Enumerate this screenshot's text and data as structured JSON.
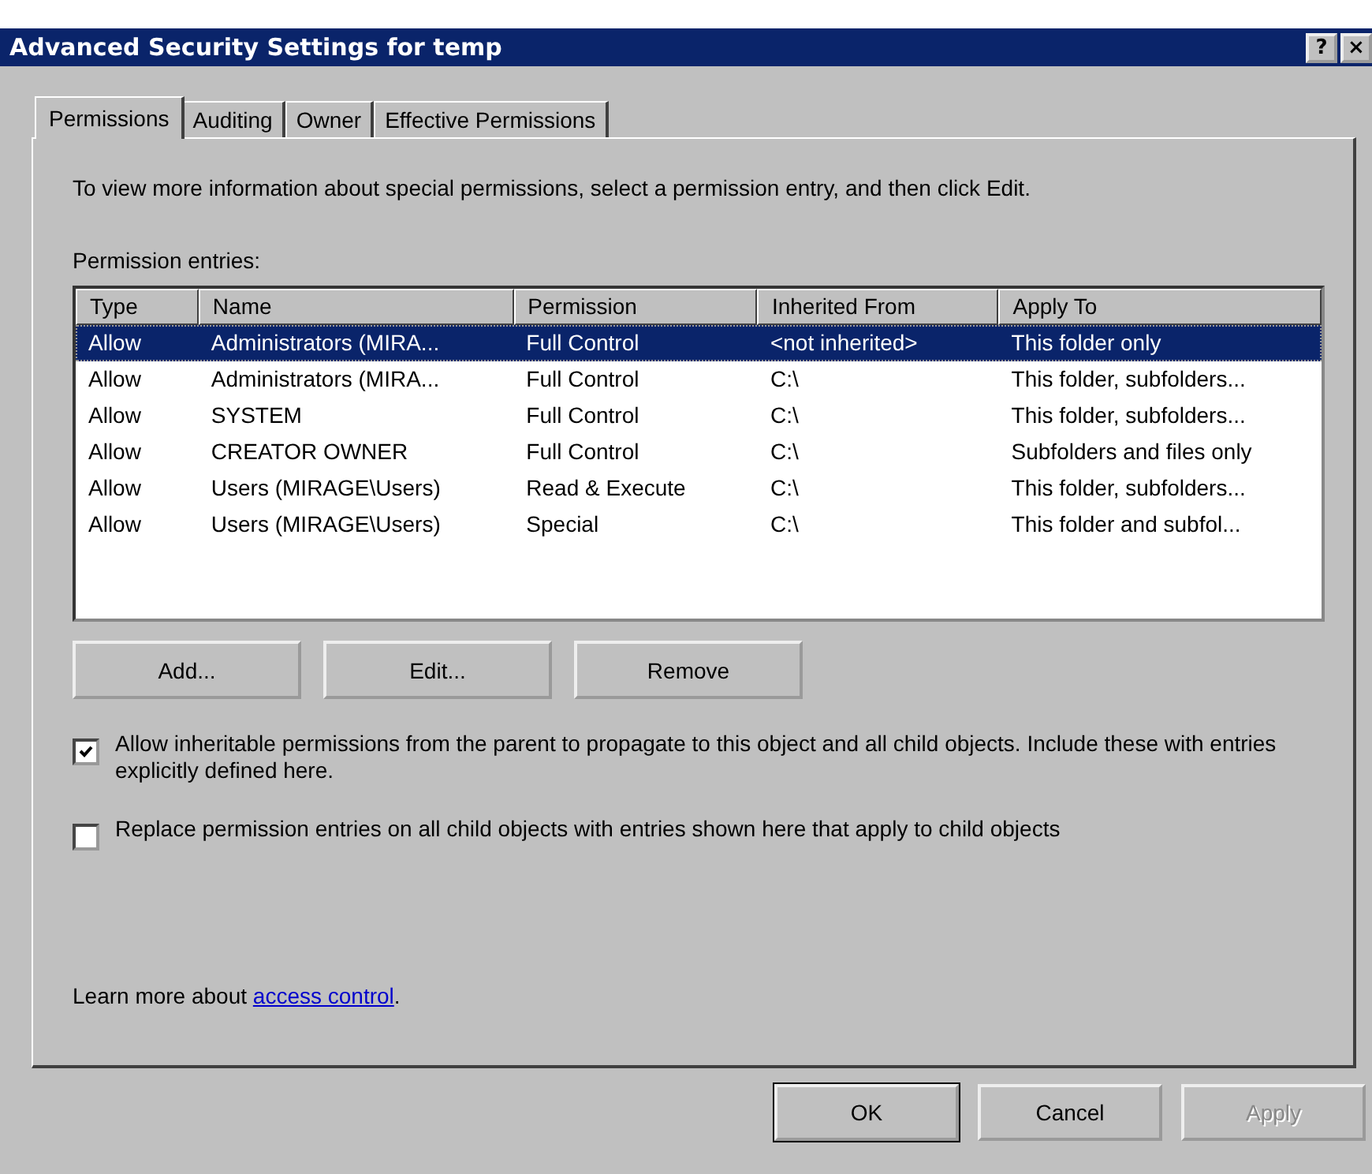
{
  "window": {
    "title": "Advanced Security Settings for temp",
    "help_button": "?",
    "close_button": "×"
  },
  "tabs": [
    {
      "label": "Permissions",
      "selected": true
    },
    {
      "label": "Auditing",
      "selected": false
    },
    {
      "label": "Owner",
      "selected": false
    },
    {
      "label": "Effective Permissions",
      "selected": false
    }
  ],
  "intro": "To view more information about special permissions, select a permission entry, and then click Edit.",
  "list_label": "Permission entries:",
  "table": {
    "columns": [
      "Type",
      "Name",
      "Permission",
      "Inherited From",
      "Apply To"
    ],
    "rows": [
      {
        "cells": [
          "Allow",
          "Administrators (MIRA...",
          "Full Control",
          "<not inherited>",
          "This folder only"
        ],
        "selected": true
      },
      {
        "cells": [
          "Allow",
          "Administrators (MIRA...",
          "Full Control",
          "C:\\",
          "This folder, subfolders..."
        ],
        "selected": false
      },
      {
        "cells": [
          "Allow",
          "SYSTEM",
          "Full Control",
          "C:\\",
          "This folder, subfolders..."
        ],
        "selected": false
      },
      {
        "cells": [
          "Allow",
          "CREATOR OWNER",
          "Full Control",
          "C:\\",
          "Subfolders and files only"
        ],
        "selected": false
      },
      {
        "cells": [
          "Allow",
          "Users (MIRAGE\\Users)",
          "Read & Execute",
          "C:\\",
          "This folder, subfolders..."
        ],
        "selected": false
      },
      {
        "cells": [
          "Allow",
          "Users (MIRAGE\\Users)",
          "Special",
          "C:\\",
          "This folder and subfol..."
        ],
        "selected": false
      }
    ]
  },
  "entry_buttons": [
    "Add...",
    "Edit...",
    "Remove"
  ],
  "options": [
    {
      "label": "Allow inheritable permissions from the parent to propagate to this object and all child objects. Include these with entries explicitly defined here.",
      "checked": true
    },
    {
      "label": "Replace permission entries on all child objects with entries shown here that apply to child objects",
      "checked": false
    }
  ],
  "learn_more": {
    "text": "Learn more about ",
    "link": "access control",
    "end": "."
  },
  "dialog_buttons": [
    {
      "label": "OK",
      "disabled": false
    },
    {
      "label": "Cancel",
      "disabled": false
    },
    {
      "label": "Apply",
      "disabled": true
    }
  ]
}
